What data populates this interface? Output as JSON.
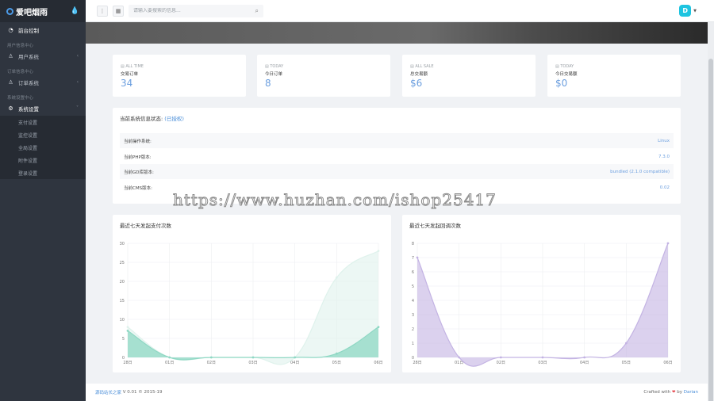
{
  "sidebar": {
    "logo": "爱吧烟雨",
    "items": [
      {
        "type": "item",
        "label": "前台控制",
        "icon": "speedometer-icon",
        "active": true
      },
      {
        "type": "head",
        "label": "用户信息中心"
      },
      {
        "type": "item",
        "label": "用户系统",
        "icon": "user-icon",
        "chevron": "‹"
      },
      {
        "type": "head",
        "label": "订单信息中心"
      },
      {
        "type": "item",
        "label": "订单系统",
        "icon": "user-icon",
        "chevron": "‹"
      },
      {
        "type": "head",
        "label": "系统设置中心"
      },
      {
        "type": "item",
        "label": "系统设置",
        "icon": "gear-icon",
        "active": true,
        "chevron": "˅"
      }
    ],
    "submenu": [
      "支付设置",
      "监控设置",
      "全局设置",
      "附件设置",
      "登录设置"
    ]
  },
  "topbar": {
    "search_placeholder": "请输入要搜索的信息...",
    "avatar_letter": "D"
  },
  "stats": [
    {
      "label": "ALL TIME",
      "name": "交易订单",
      "value": "34"
    },
    {
      "label": "TODAY",
      "name": "今日订单",
      "value": "8"
    },
    {
      "label": "ALL SALE",
      "name": "总交易额",
      "value": "$6"
    },
    {
      "label": "TODAY",
      "name": "今日交易额",
      "value": "$0"
    }
  ],
  "sysinfo": {
    "title": "当前系统信息状态:",
    "auth": "(已授权)",
    "rows": [
      {
        "k": "当前操作系统:",
        "v": "Linux"
      },
      {
        "k": "当前PHP版本:",
        "v": "7.3.0"
      },
      {
        "k": "当前GD库版本:",
        "v": "bundled (2.1.0 compatible)"
      },
      {
        "k": "当前CMS版本:",
        "v": "0.02"
      }
    ]
  },
  "watermark": "https://www.huzhan.com/ishop25417",
  "chart_data": [
    {
      "type": "area",
      "title": "最近七天发起支付次数",
      "categories": [
        "28日",
        "01日",
        "02日",
        "03日",
        "04日",
        "05日",
        "06日"
      ],
      "ylim": [
        0,
        30
      ],
      "yticks": [
        0,
        5,
        10,
        15,
        20,
        25,
        30
      ],
      "series": [
        {
          "values": [
            7,
            0,
            0,
            0,
            0,
            1,
            8
          ],
          "color": "#8fd8c4"
        },
        {
          "values": [
            8,
            0,
            0,
            0,
            0,
            21,
            28
          ],
          "color": "#dff2ec"
        }
      ]
    },
    {
      "type": "area",
      "title": "最近七天发起回调次数",
      "categories": [
        "28日",
        "01日",
        "02日",
        "03日",
        "04日",
        "05日",
        "06日"
      ],
      "ylim": [
        0,
        8
      ],
      "yticks": [
        0,
        1,
        2,
        3,
        4,
        5,
        6,
        7,
        8
      ],
      "series": [
        {
          "values": [
            7,
            0,
            0,
            0,
            0,
            1,
            8
          ],
          "color": "#c3b3e3"
        }
      ]
    }
  ],
  "footer": {
    "brand": "源码站长之家",
    "version": "V 0.01",
    "copy": "© 2015-19",
    "crafted": "Crafted with",
    "heart": "❤",
    "by": "by",
    "author": "Darian"
  }
}
